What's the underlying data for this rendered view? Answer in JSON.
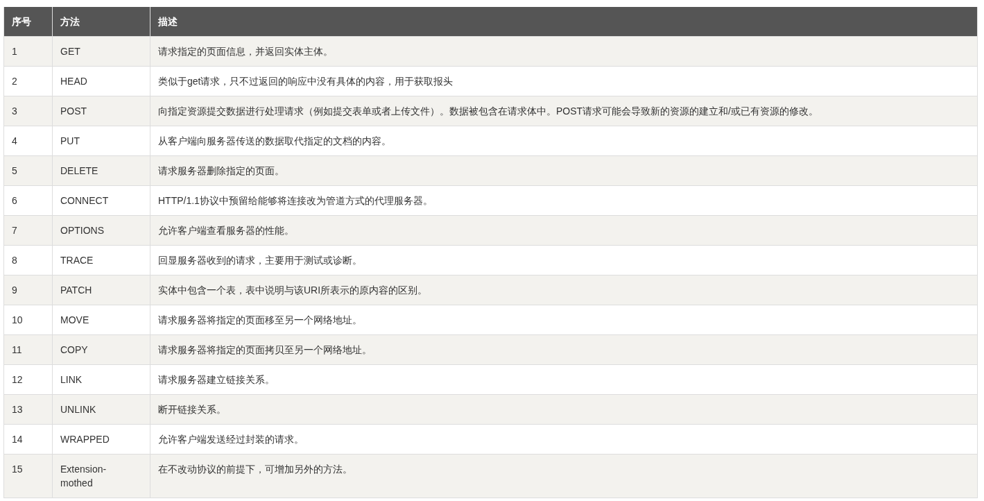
{
  "table": {
    "columns": [
      "序号",
      "方法",
      "描述"
    ],
    "rows": [
      {
        "index": "1",
        "method": "GET",
        "description": "请求指定的页面信息，并返回实体主体。"
      },
      {
        "index": "2",
        "method": "HEAD",
        "description": "类似于get请求，只不过返回的响应中没有具体的内容，用于获取报头"
      },
      {
        "index": "3",
        "method": "POST",
        "description": "向指定资源提交数据进行处理请求（例如提交表单或者上传文件）。数据被包含在请求体中。POST请求可能会导致新的资源的建立和/或已有资源的修改。"
      },
      {
        "index": "4",
        "method": "PUT",
        "description": "从客户端向服务器传送的数据取代指定的文档的内容。"
      },
      {
        "index": "5",
        "method": "DELETE",
        "description": "请求服务器删除指定的页面。"
      },
      {
        "index": "6",
        "method": "CONNECT",
        "description": "HTTP/1.1协议中预留给能够将连接改为管道方式的代理服务器。"
      },
      {
        "index": "7",
        "method": "OPTIONS",
        "description": "允许客户端查看服务器的性能。"
      },
      {
        "index": "8",
        "method": "TRACE",
        "description": "回显服务器收到的请求，主要用于测试或诊断。"
      },
      {
        "index": "9",
        "method": "PATCH",
        "description": "实体中包含一个表，表中说明与该URI所表示的原内容的区别。"
      },
      {
        "index": "10",
        "method": "MOVE",
        "description": "请求服务器将指定的页面移至另一个网络地址。"
      },
      {
        "index": "11",
        "method": "COPY",
        "description": "请求服务器将指定的页面拷贝至另一个网络地址。"
      },
      {
        "index": "12",
        "method": "LINK",
        "description": "请求服务器建立链接关系。"
      },
      {
        "index": "13",
        "method": "UNLINK",
        "description": "断开链接关系。"
      },
      {
        "index": "14",
        "method": "WRAPPED",
        "description": "允许客户端发送经过封装的请求。"
      },
      {
        "index": "15",
        "method": "Extension-mothed",
        "description": "在不改动协议的前提下，可增加另外的方法。"
      }
    ]
  }
}
